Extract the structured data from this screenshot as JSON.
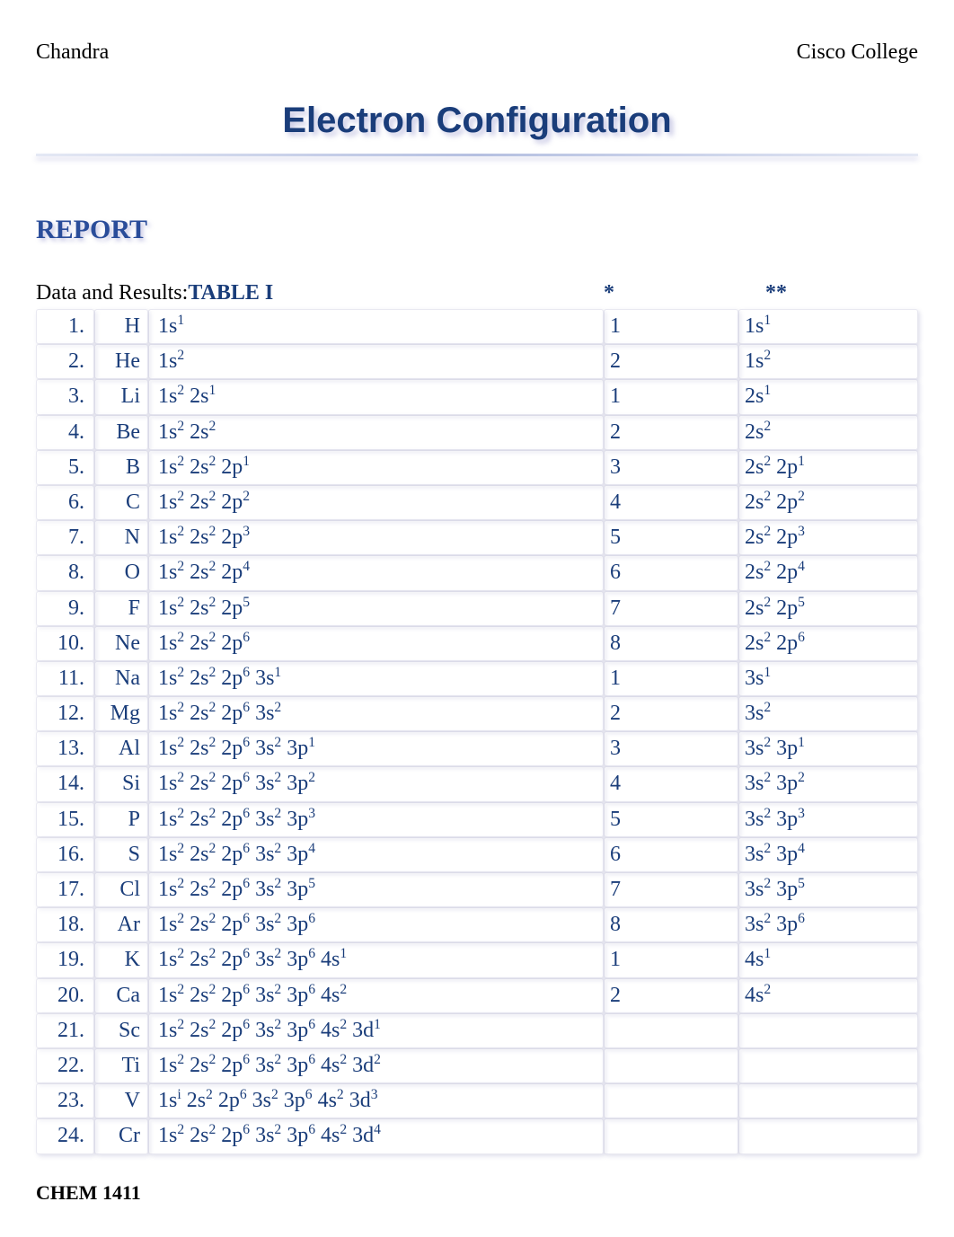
{
  "header": {
    "left": "Chandra",
    "right": "Cisco College"
  },
  "title": "Electron Configuration",
  "section": "REPORT",
  "results": {
    "label": "Data and Results:  ",
    "table_label": "TABLE I",
    "star1_header": "*",
    "star2_header": "**"
  },
  "chart_data": {
    "type": "table",
    "columns": [
      "num",
      "symbol",
      "configuration",
      "star1",
      "star2"
    ],
    "rows": [
      {
        "num": "1.",
        "symbol": "H",
        "conf": "1s^1",
        "star1": "1",
        "star2": "1s^1"
      },
      {
        "num": "2.",
        "symbol": "He",
        "conf": "1s^2",
        "star1": "2",
        "star2": "1s^2"
      },
      {
        "num": "3.",
        "symbol": "Li",
        "conf": "1s^2 2s^1",
        "star1": "1",
        "star2": "2s^1"
      },
      {
        "num": "4.",
        "symbol": "Be",
        "conf": "1s^2 2s^2",
        "star1": "2",
        "star2": "2s^2"
      },
      {
        "num": "5.",
        "symbol": "B",
        "conf": "1s^2 2s^2 2p^1",
        "star1": "3",
        "star2": "2s^2 2p^1"
      },
      {
        "num": "6.",
        "symbol": "C",
        "conf": "1s^2 2s^2 2p^2",
        "star1": "4",
        "star2": "2s^2 2p^2"
      },
      {
        "num": "7.",
        "symbol": "N",
        "conf": "1s^2 2s^2 2p^3",
        "star1": "5",
        "star2": "2s^2 2p^3"
      },
      {
        "num": "8.",
        "symbol": "O",
        "conf": "1s^2 2s^2 2p^4",
        "star1": "6",
        "star2": "2s^2 2p^4"
      },
      {
        "num": "9.",
        "symbol": "F",
        "conf": "1s^2 2s^2 2p^5",
        "star1": "7",
        "star2": "2s^2 2p^5"
      },
      {
        "num": "10.",
        "symbol": "Ne",
        "conf": "1s^2 2s^2 2p^6",
        "star1": "8",
        "star2": "2s^2 2p^6"
      },
      {
        "num": "11.",
        "symbol": "Na",
        "conf": "1s^2 2s^2 2p^6 3s^1",
        "star1": "1",
        "star2": "3s^1"
      },
      {
        "num": "12.",
        "symbol": "Mg",
        "conf": "1s^2 2s^2 2p^6 3s^2",
        "star1": "2",
        "star2": "3s^2"
      },
      {
        "num": "13.",
        "symbol": "Al",
        "conf": "1s^2 2s^2 2p^6 3s^2 3p^1",
        "star1": "3",
        "star2": "3s^2 3p^1"
      },
      {
        "num": "14.",
        "symbol": "Si",
        "conf": "1s^2 2s^2 2p^6 3s^2 3p^2",
        "star1": "4",
        "star2": "3s^2 3p^2"
      },
      {
        "num": "15.",
        "symbol": "P",
        "conf": "1s^2 2s^2 2p^6 3s^2 3p^3",
        "star1": "5",
        "star2": "3s^2 3p^3"
      },
      {
        "num": "16.",
        "symbol": "S",
        "conf": "1s^2 2s^2 2p^6 3s^2 3p^4",
        "star1": "6",
        "star2": "3s^2 3p^4"
      },
      {
        "num": "17.",
        "symbol": "Cl",
        "conf": "1s^2 2s^2 2p^6 3s^2 3p^5",
        "star1": "7",
        "star2": "3s^2 3p^5"
      },
      {
        "num": "18.",
        "symbol": "Ar",
        "conf": "1s^2 2s^2 2p^6 3s^2 3p^6",
        "star1": "8",
        "star2": "3s^2 3p^6"
      },
      {
        "num": "19.",
        "symbol": "K",
        "conf": "1s^2 2s^2 2p^6 3s^2 3p^6 4s^1",
        "star1": "1",
        "star2": "4s^1"
      },
      {
        "num": "20.",
        "symbol": "Ca",
        "conf": "1s^2 2s^2 2p^6 3s^2 3p^6 4s^2",
        "star1": "2",
        "star2": "4s^2"
      },
      {
        "num": "21.",
        "symbol": "Sc",
        "conf": "1s^2 2s^2 2p^6 3s^2 3p^6 4s^2 3d^1",
        "star1": "",
        "star2": ""
      },
      {
        "num": "22.",
        "symbol": "Ti",
        "conf": "1s^2 2s^2 2p^6 3s^2 3p^6 4s^2 3d^2",
        "star1": "",
        "star2": ""
      },
      {
        "num": "23.",
        "symbol": "V",
        "conf": "1s^i 2s^2 2p^6 3s^2 3p^6 4s^2 3d^3",
        "star1": "",
        "star2": ""
      },
      {
        "num": "24.",
        "symbol": "Cr",
        "conf": "1s^2 2s^2 2p^6 3s^2 3p^6 4s^2 3d^4",
        "star1": "",
        "star2": ""
      }
    ]
  },
  "footer": "CHEM 1411"
}
